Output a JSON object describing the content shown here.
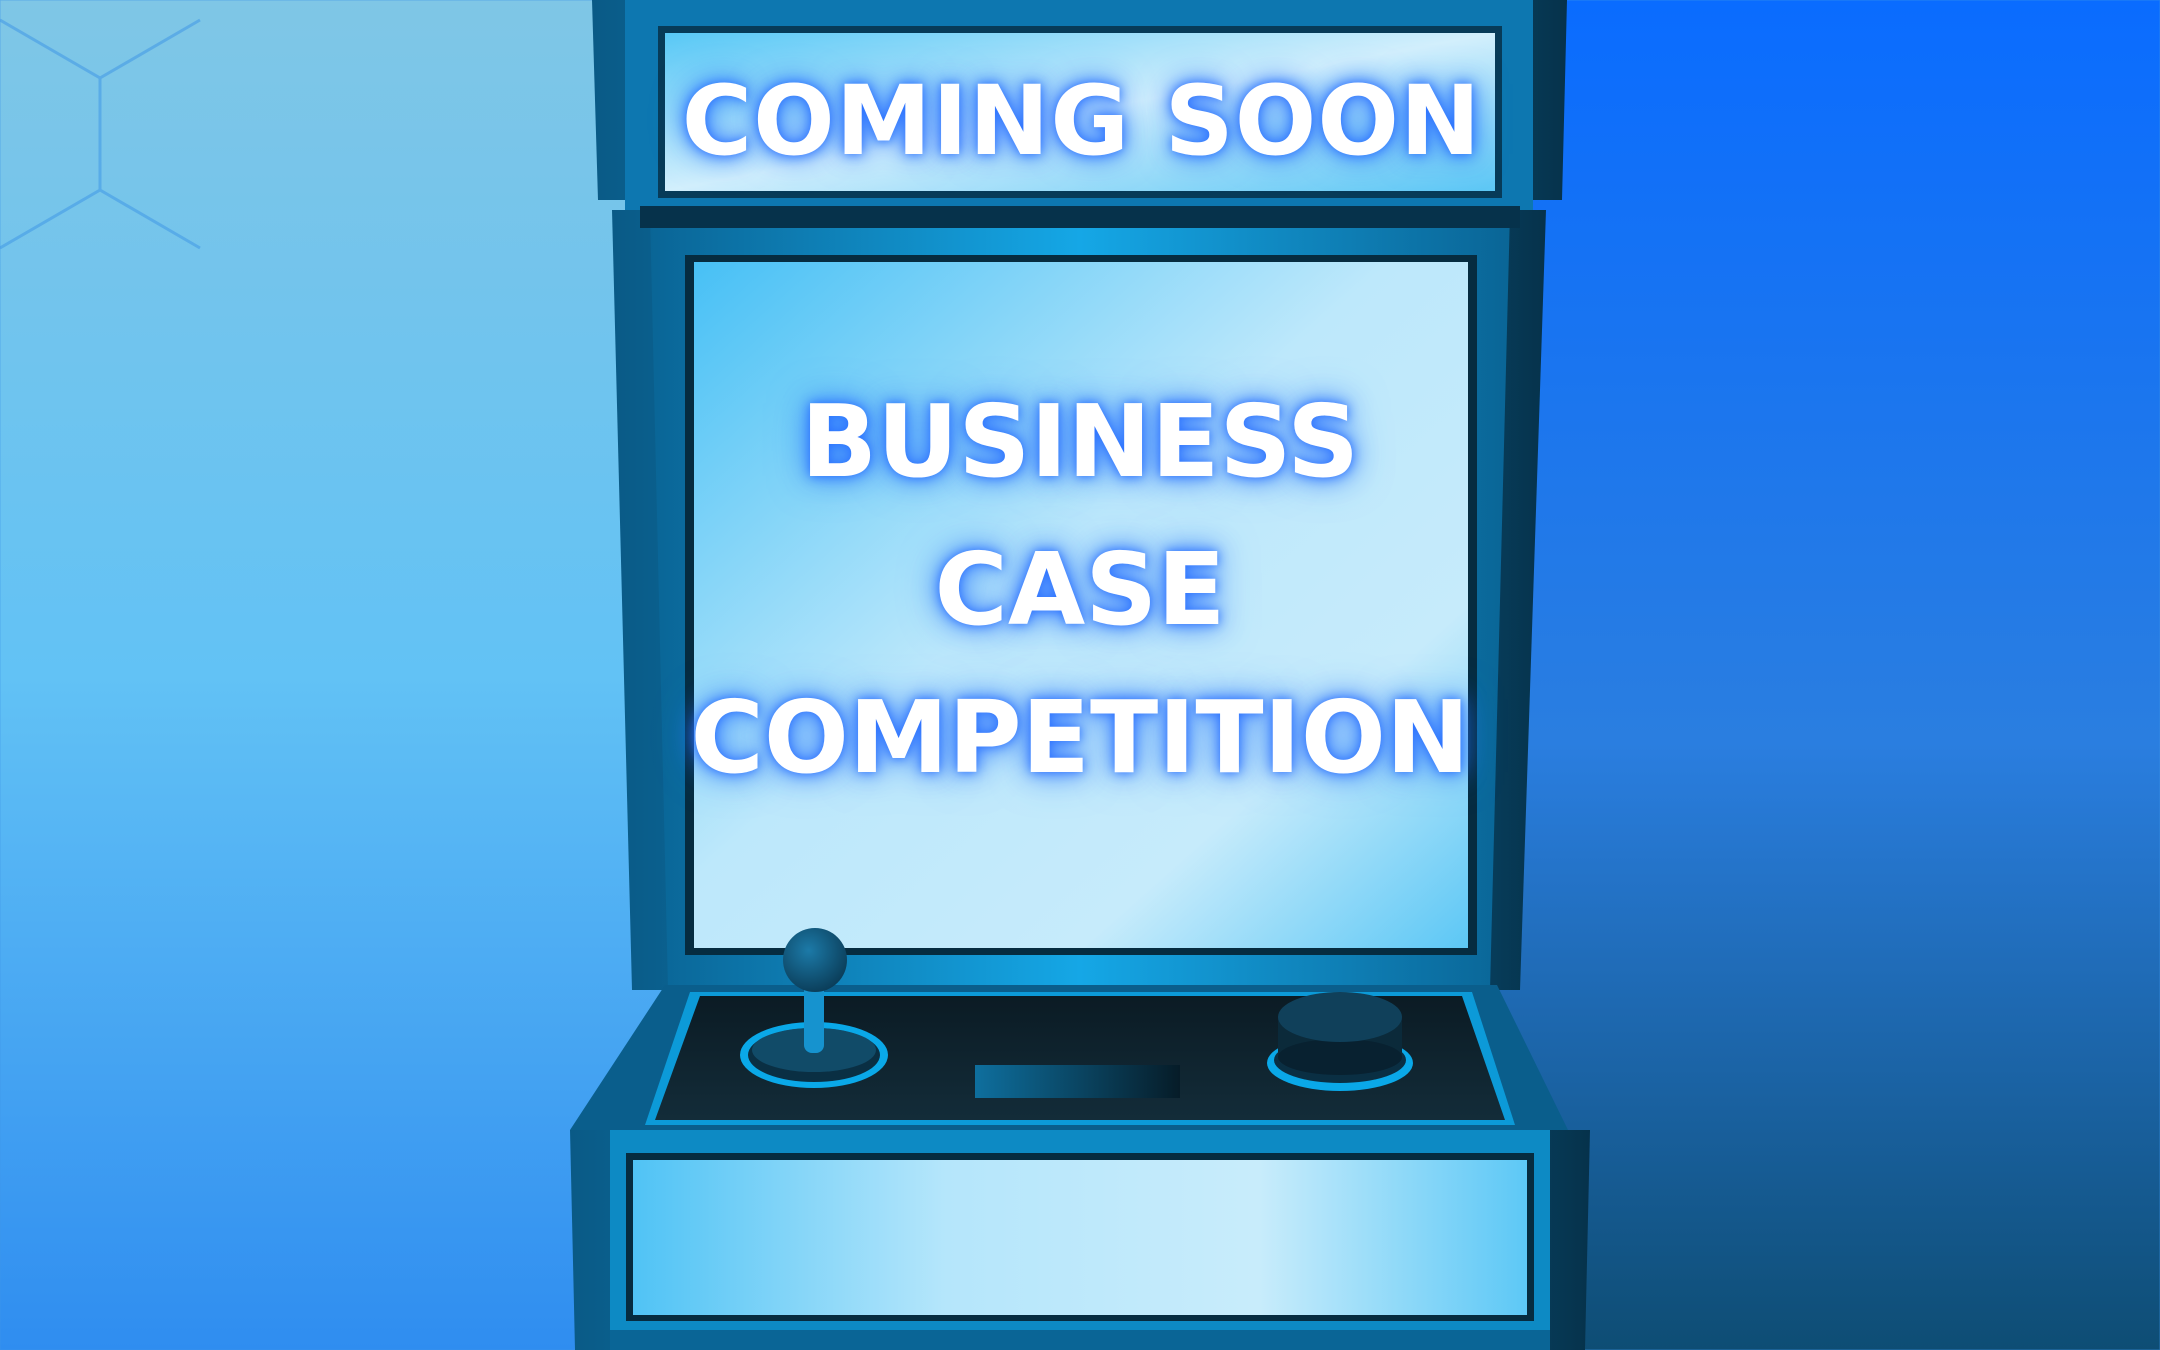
{
  "marquee": {
    "label": "COMING SOON"
  },
  "screen": {
    "lines": [
      "BUSINESS",
      "CASE",
      "COMPETITION"
    ]
  },
  "colors": {
    "background_left": "#5cc7f5",
    "background_right": "#0a6cff",
    "cabinet_body": "#0b87c4",
    "cabinet_dark": "#041a26",
    "panel_light": "#bfe8fb",
    "glow": "#2a6cff"
  },
  "icons": [
    "joystick-icon",
    "arcade-button-icon"
  ]
}
